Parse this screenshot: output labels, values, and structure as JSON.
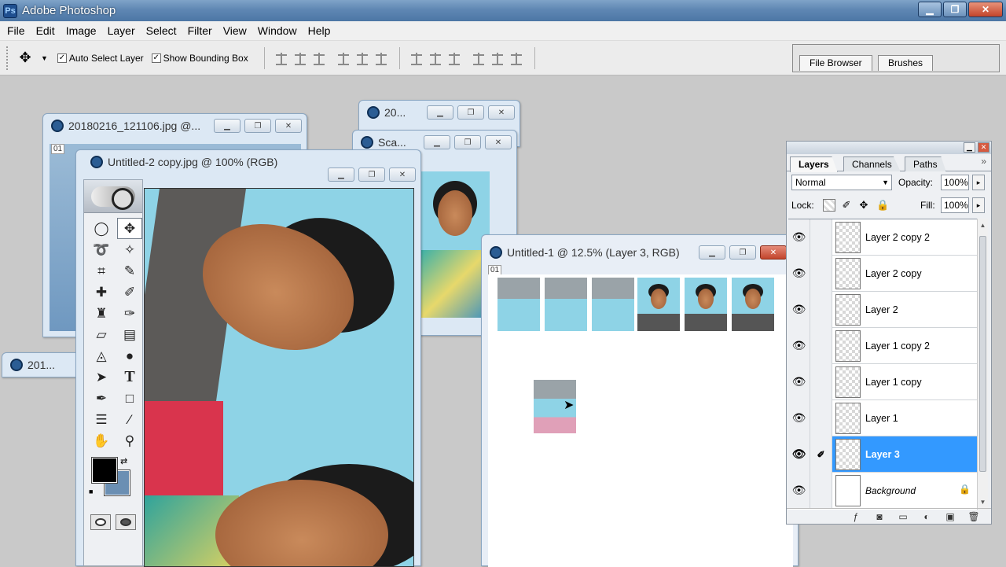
{
  "app": {
    "title": "Adobe Photoshop",
    "icon": "photoshop-app-icon"
  },
  "window_controls": {
    "minimize": "▁",
    "restore": "❐",
    "close": "✕"
  },
  "menu": [
    "File",
    "Edit",
    "Image",
    "Layer",
    "Select",
    "Filter",
    "View",
    "Window",
    "Help"
  ],
  "options": {
    "auto_select_label": "Auto Select Layer",
    "auto_select_checked": "✓",
    "bounding_box_label": "Show Bounding Box",
    "bounding_box_checked": "✓"
  },
  "palette_well": {
    "tabs": [
      "File Browser",
      "Brushes"
    ]
  },
  "documents": {
    "doc1": {
      "title": "20180216_121106.jpg @..."
    },
    "doc2": {
      "title": "20..."
    },
    "doc3": {
      "title": "Sca..."
    },
    "doc4": {
      "title": "201..."
    },
    "doc_main": {
      "title": "Untitled-2 copy.jpg @ 100% (RGB)"
    },
    "doc_untitled1": {
      "title": "Untitled-1 @ 12.5% (Layer 3, RGB)"
    },
    "page_num": "01"
  },
  "layers_panel": {
    "tabs": [
      "Layers",
      "Channels",
      "Paths"
    ],
    "blend_mode": "Normal",
    "opacity_label": "Opacity:",
    "opacity_value": "100%",
    "lock_label": "Lock:",
    "fill_label": "Fill:",
    "fill_value": "100%",
    "layers": [
      {
        "name": "Layer 2 copy 2"
      },
      {
        "name": "Layer 2 copy"
      },
      {
        "name": "Layer 2"
      },
      {
        "name": "Layer 1 copy 2"
      },
      {
        "name": "Layer 1 copy"
      },
      {
        "name": "Layer 1"
      },
      {
        "name": "Layer 3"
      },
      {
        "name": "Background"
      }
    ],
    "selected_layer": "Layer 3"
  },
  "colors": {
    "foreground": "#000000",
    "background": "#6b8fb3",
    "selection": "#3399ff",
    "title_bar": "#5f87b3"
  }
}
